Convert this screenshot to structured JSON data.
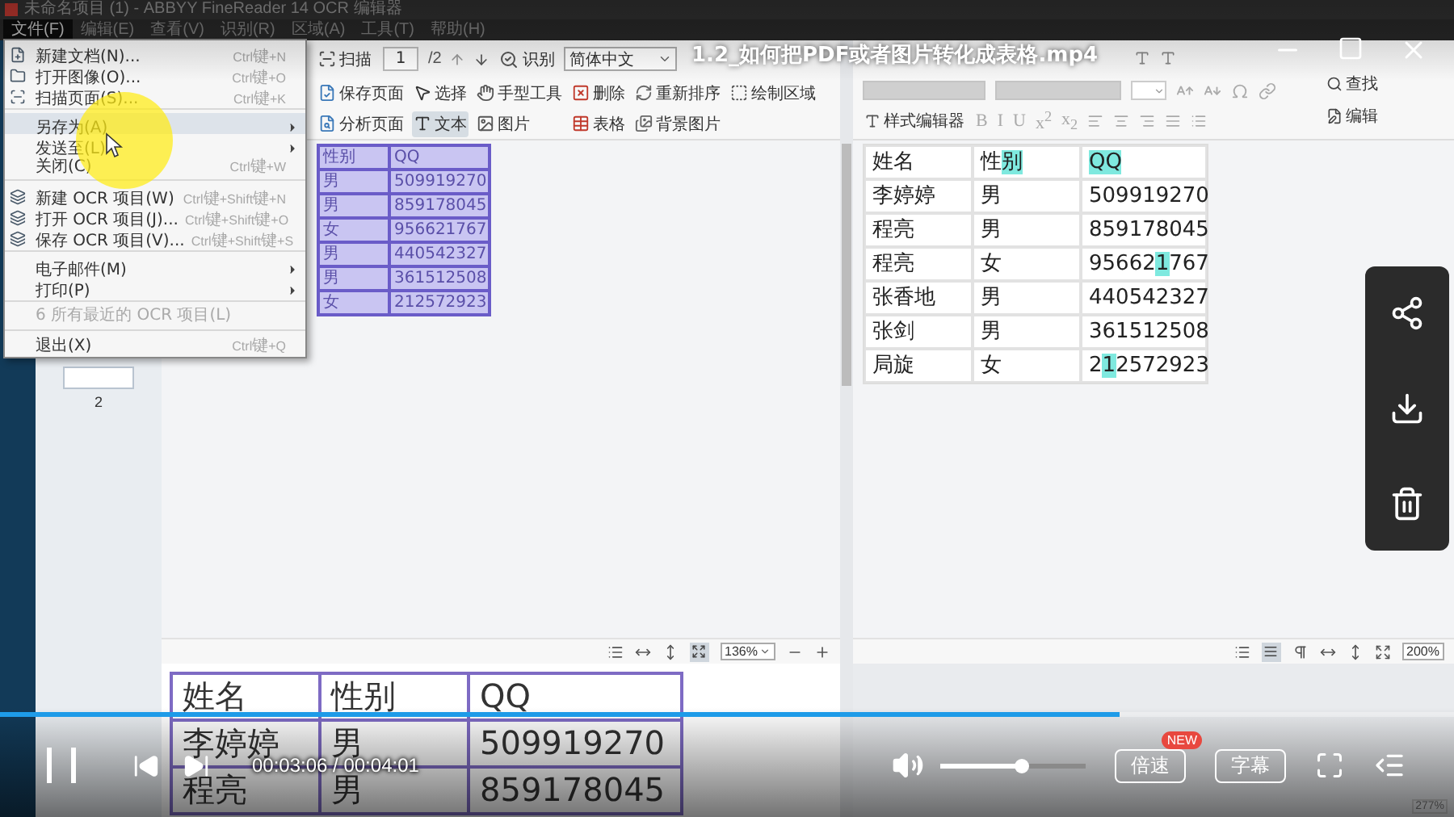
{
  "player": {
    "title": "1.2_如何把PDF或者图片转化成表格.mp4",
    "progress": {
      "level": 0.77
    },
    "playing": true,
    "time": "00:03:06 / 00:04:01",
    "volume": {
      "level": 0.55
    },
    "buttons": [
      {
        "label": "倍速",
        "badge": "NEW"
      },
      {
        "label": "字幕"
      }
    ],
    "side_actions": [
      {
        "kind": "share"
      },
      {
        "kind": "download"
      },
      {
        "kind": "delete"
      }
    ]
  },
  "app": {
    "title": "未命名项目 (1) - ABBYY FineReader 14 OCR 编辑器",
    "menus": [
      {
        "label": "文件(F)",
        "selected": true
      },
      {
        "label": "编辑(E)",
        "selected": false
      },
      {
        "label": "查看(V)",
        "selected": false
      },
      {
        "label": "识别(R)",
        "selected": false
      },
      {
        "label": "区域(A)",
        "selected": false
      },
      {
        "label": "工具(T)",
        "selected": false
      },
      {
        "label": "帮助(H)",
        "selected": false
      }
    ],
    "file_menu": [
      [
        {
          "label": "新建文档(N)...",
          "shortcut": "Ctrl键+N",
          "submenu": false,
          "highlighted": false,
          "disabled": false
        },
        {
          "label": "打开图像(O)...",
          "shortcut": "Ctrl键+O",
          "submenu": false,
          "highlighted": false,
          "disabled": false
        },
        {
          "label": "扫描页面(S)...",
          "shortcut": "Ctrl键+K",
          "submenu": false,
          "highlighted": false,
          "disabled": false
        }
      ],
      [
        {
          "label": "另存为(A)",
          "submenu": true,
          "highlighted": true,
          "disabled": false
        },
        {
          "label": "发送至(L)",
          "submenu": true,
          "highlighted": false,
          "disabled": false
        },
        {
          "label": "关闭(C)",
          "shortcut": "Ctrl键+W",
          "submenu": false,
          "highlighted": false,
          "disabled": false
        }
      ],
      [
        {
          "label": "新建 OCR 项目(W)",
          "shortcut": "Ctrl键+Shift键+N",
          "submenu": false,
          "highlighted": false,
          "disabled": false
        },
        {
          "label": "打开 OCR 项目(J)...",
          "shortcut": "Ctrl键+Shift键+O",
          "submenu": false,
          "highlighted": false,
          "disabled": false
        },
        {
          "label": "保存 OCR 项目(V)...",
          "shortcut": "Ctrl键+Shift键+S",
          "submenu": false,
          "highlighted": false,
          "disabled": false
        }
      ],
      [
        {
          "label": "电子邮件(M)",
          "submenu": true,
          "highlighted": false,
          "disabled": false
        },
        {
          "label": "打印(P)",
          "submenu": true,
          "highlighted": false,
          "disabled": false
        }
      ],
      [
        {
          "label": "6 所有最近的 OCR 项目(L)",
          "submenu": false,
          "highlighted": false,
          "disabled": true
        }
      ],
      [
        {
          "label": "退出(X)",
          "shortcut": "Ctrl键+Q",
          "submenu": false,
          "highlighted": false,
          "disabled": false
        }
      ]
    ],
    "toolbar": {
      "scan": "扫描",
      "page": "1",
      "page_count": "/2",
      "recognize": "识别",
      "language": "简体中文"
    },
    "tools": [
      [
        {
          "label": "保存页面",
          "selected": false
        },
        {
          "label": "分析页面",
          "selected": false
        }
      ],
      [
        {
          "label": "选择",
          "selected": false
        },
        {
          "label": "文本",
          "selected": true
        }
      ],
      [
        {
          "label": "手型工具",
          "selected": false
        },
        {
          "label": "图片",
          "selected": false
        }
      ],
      [
        {
          "label": "删除",
          "selected": false
        },
        {
          "label": "表格",
          "selected": false
        }
      ],
      [
        {
          "label": "重新排序",
          "selected": false
        },
        {
          "label": "背景图片",
          "selected": false
        }
      ],
      [
        {
          "label": "绘制区域",
          "selected": false
        }
      ]
    ],
    "text_toolbar": {
      "style_editor": "样式编辑器",
      "format_buttons": [
        "B",
        "I",
        "U",
        "x$^{2}$",
        "x$_{2}$"
      ],
      "find": "查找",
      "edit": "编辑"
    },
    "sidebar": {
      "page_label": "2"
    },
    "image_table": {
      "columns": [
        "性别",
        "QQ"
      ],
      "rows": [
        [
          "男",
          "509919270"
        ],
        [
          "男",
          "859178045"
        ],
        [
          "女",
          "956621767"
        ],
        [
          "男",
          "440542327"
        ],
        [
          "男",
          "361512508"
        ],
        [
          "女",
          "212572923"
        ]
      ]
    },
    "image_zoom": "136%",
    "preview_table": [
      [
        "姓名",
        "性别",
        "QQ"
      ],
      [
        "李婷婷",
        "男",
        "509919270"
      ],
      [
        "程亮",
        "男",
        "859178045"
      ]
    ],
    "text_table": [
      [
        [
          {
            "text": "姓名",
            "highlighted": false
          }
        ],
        [
          {
            "text": "性",
            "highlighted": false
          },
          {
            "text": "别",
            "highlighted": true
          }
        ],
        [
          {
            "text": "QQ",
            "highlighted": true
          }
        ]
      ],
      [
        [
          {
            "text": "李婷婷",
            "highlighted": false
          }
        ],
        [
          {
            "text": "男",
            "highlighted": false
          }
        ],
        [
          {
            "text": "509919270",
            "highlighted": false
          }
        ]
      ],
      [
        [
          {
            "text": "程亮",
            "highlighted": false
          }
        ],
        [
          {
            "text": "男",
            "highlighted": false
          }
        ],
        [
          {
            "text": "859178045",
            "highlighted": false
          }
        ]
      ],
      [
        [
          {
            "text": "程亮",
            "highlighted": false
          }
        ],
        [
          {
            "text": "女",
            "highlighted": false
          }
        ],
        [
          {
            "text": "95662",
            "highlighted": false
          },
          {
            "text": "1",
            "highlighted": true
          },
          {
            "text": "767",
            "highlighted": false
          }
        ]
      ],
      [
        [
          {
            "text": "张香地",
            "highlighted": false
          }
        ],
        [
          {
            "text": "男",
            "highlighted": false
          }
        ],
        [
          {
            "text": "440542327",
            "highlighted": false
          }
        ]
      ],
      [
        [
          {
            "text": "张剑",
            "highlighted": false
          }
        ],
        [
          {
            "text": "男",
            "highlighted": false
          }
        ],
        [
          {
            "text": "361512508",
            "highlighted": false
          }
        ]
      ],
      [
        [
          {
            "text": "局旋",
            "highlighted": false
          }
        ],
        [
          {
            "text": "女",
            "highlighted": false
          }
        ],
        [
          {
            "text": "2",
            "highlighted": false
          },
          {
            "text": "1",
            "highlighted": true
          },
          {
            "text": "2572923",
            "highlighted": false
          }
        ]
      ]
    ],
    "text_zoom": "200%",
    "status_zoom": "277%"
  }
}
